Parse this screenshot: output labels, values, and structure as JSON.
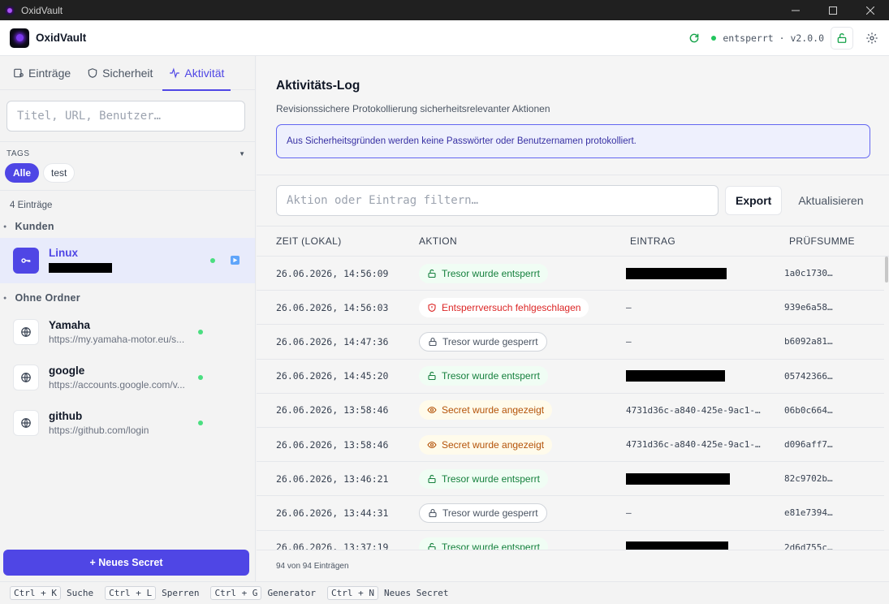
{
  "window": {
    "title": "OxidVault"
  },
  "header": {
    "brand": "OxidVault",
    "status_text": "entsperrt · v2.0.0",
    "icons": [
      "refresh-icon",
      "lock-open-icon",
      "gear-icon"
    ]
  },
  "sidebar": {
    "tabs": [
      {
        "label": "Einträge",
        "icon": "entries-icon",
        "active": false
      },
      {
        "label": "Sicherheit",
        "icon": "shield-icon",
        "active": false
      },
      {
        "label": "Aktivität",
        "icon": "activity-icon",
        "active": true
      }
    ],
    "search_placeholder": "Titel, URL, Benutzer…",
    "tags_label": "TAGS",
    "tags": [
      {
        "label": "Alle",
        "active": true
      },
      {
        "label": "test",
        "active": false
      }
    ],
    "count_label": "4 Einträge",
    "folders": [
      {
        "name": "Kunden",
        "entries": [
          {
            "name": "Linux",
            "url": "",
            "icon": "key-icon",
            "selected": true,
            "redacted": true
          }
        ]
      },
      {
        "name": "Ohne Ordner",
        "entries": [
          {
            "name": "Yamaha",
            "url": "https://my.yamaha-motor.eu/s...",
            "icon": "globe-icon",
            "selected": false
          },
          {
            "name": "google",
            "url": "https://accounts.google.com/v...",
            "icon": "globe-icon",
            "selected": false
          },
          {
            "name": "github",
            "url": "https://github.com/login",
            "icon": "globe-icon",
            "selected": false
          }
        ]
      }
    ],
    "new_secret_label": "+ Neues Secret"
  },
  "main": {
    "title": "Aktivitäts-Log",
    "subtitle": "Revisionssichere Protokollierung sicherheitsrelevanter Aktionen",
    "info": "Aus Sicherheitsgründen werden keine Passwörter oder Benutzernamen protokolliert.",
    "filter_placeholder": "Aktion oder Eintrag filtern…",
    "export_label": "Export",
    "refresh_label": "Aktualisieren",
    "columns": {
      "time": "ZEIT (LOKAL)",
      "action": "AKTION",
      "entry": "EINTRAG",
      "checksum": "PRÜFSUMME"
    },
    "rows": [
      {
        "time": "26.06.2026, 14:56:09",
        "action": "Tresor wurde entsperrt",
        "kind": "unlock",
        "entry": "",
        "redacted": true,
        "checksum": "1a0c1730…"
      },
      {
        "time": "26.06.2026, 14:56:03",
        "action": "Entsperrversuch fehlgeschlagen",
        "kind": "failed",
        "entry": "–",
        "redacted": false,
        "checksum": "939e6a58…"
      },
      {
        "time": "26.06.2026, 14:47:36",
        "action": "Tresor wurde gesperrt",
        "kind": "lock",
        "entry": "–",
        "redacted": false,
        "checksum": "b6092a81…"
      },
      {
        "time": "26.06.2026, 14:45:20",
        "action": "Tresor wurde entsperrt",
        "kind": "unlock",
        "entry": "",
        "redacted": true,
        "checksum": "05742366…"
      },
      {
        "time": "26.06.2026, 13:58:46",
        "action": "Secret wurde angezeigt",
        "kind": "view",
        "entry": "4731d36c-a840-425e-9ac1-…",
        "redacted": false,
        "checksum": "06b0c664…"
      },
      {
        "time": "26.06.2026, 13:58:46",
        "action": "Secret wurde angezeigt",
        "kind": "view",
        "entry": "4731d36c-a840-425e-9ac1-…",
        "redacted": false,
        "checksum": "d096aff7…"
      },
      {
        "time": "26.06.2026, 13:46:21",
        "action": "Tresor wurde entsperrt",
        "kind": "unlock",
        "entry": "",
        "redacted": true,
        "checksum": "82c9702b…"
      },
      {
        "time": "26.06.2026, 13:44:31",
        "action": "Tresor wurde gesperrt",
        "kind": "lock",
        "entry": "–",
        "redacted": false,
        "checksum": "e81e7394…"
      },
      {
        "time": "26.06.2026, 13:37:19",
        "action": "Tresor wurde entsperrt",
        "kind": "unlock",
        "entry": "",
        "redacted": true,
        "checksum": "2d6d755c…"
      }
    ],
    "footer_count": "94 von 94 Einträgen"
  },
  "shortcuts": [
    {
      "keys": "Ctrl + K",
      "label": "Suche"
    },
    {
      "keys": "Ctrl + L",
      "label": "Sperren"
    },
    {
      "keys": "Ctrl + G",
      "label": "Generator"
    },
    {
      "keys": "Ctrl + N",
      "label": "Neues Secret"
    }
  ],
  "colors": {
    "accent": "#4f46e5",
    "success": "#16a34a",
    "danger": "#dc2626",
    "warning": "#b45309"
  }
}
